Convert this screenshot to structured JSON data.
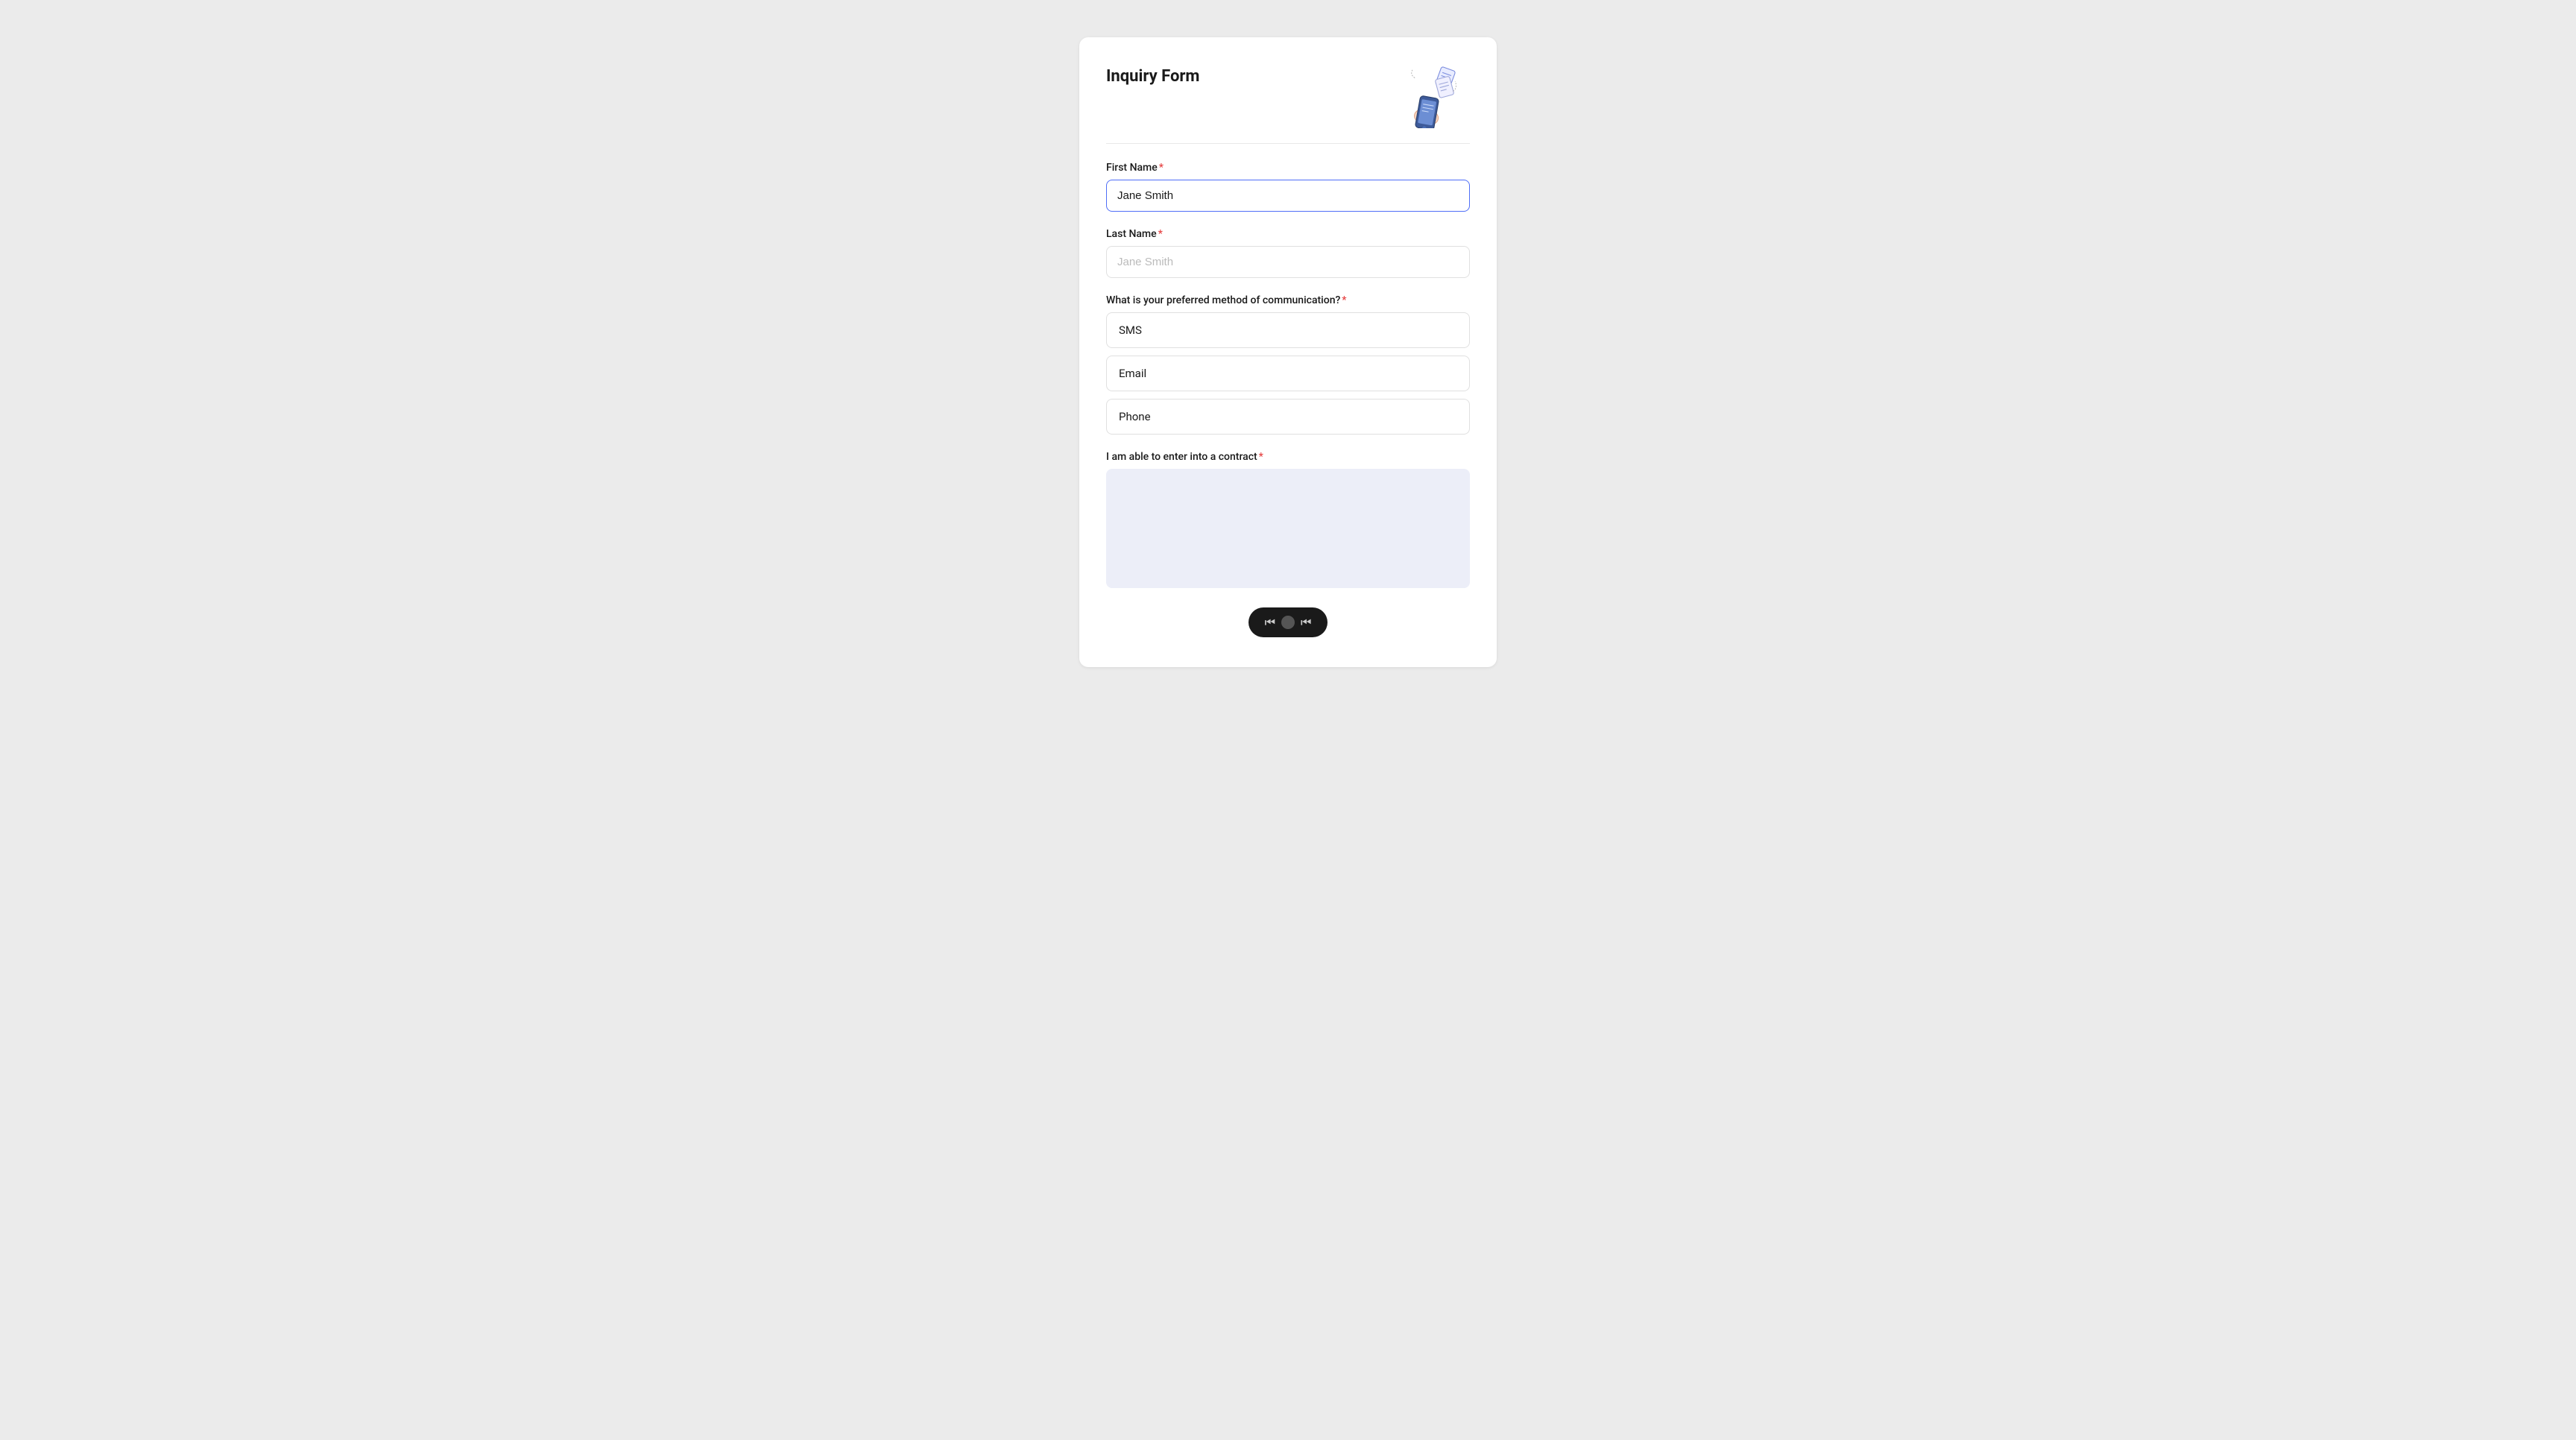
{
  "form": {
    "title": "Inquiry Form",
    "fields": {
      "first_name": {
        "label": "First Name",
        "placeholder": "Jane Smith",
        "value": "Jane Smith",
        "required": true
      },
      "last_name": {
        "label": "Last Name",
        "placeholder": "Jane Smith",
        "value": "",
        "required": true
      },
      "communication": {
        "label": "What is your preferred method of communication?",
        "required": true,
        "options": [
          {
            "label": "SMS",
            "value": "sms"
          },
          {
            "label": "Email",
            "value": "email"
          },
          {
            "label": "Phone",
            "value": "phone"
          }
        ]
      },
      "contract": {
        "label": "I am able to enter into a contract",
        "required": true,
        "placeholder": ""
      }
    }
  },
  "nav": {
    "back_label": "◀◀ ◀◀"
  }
}
